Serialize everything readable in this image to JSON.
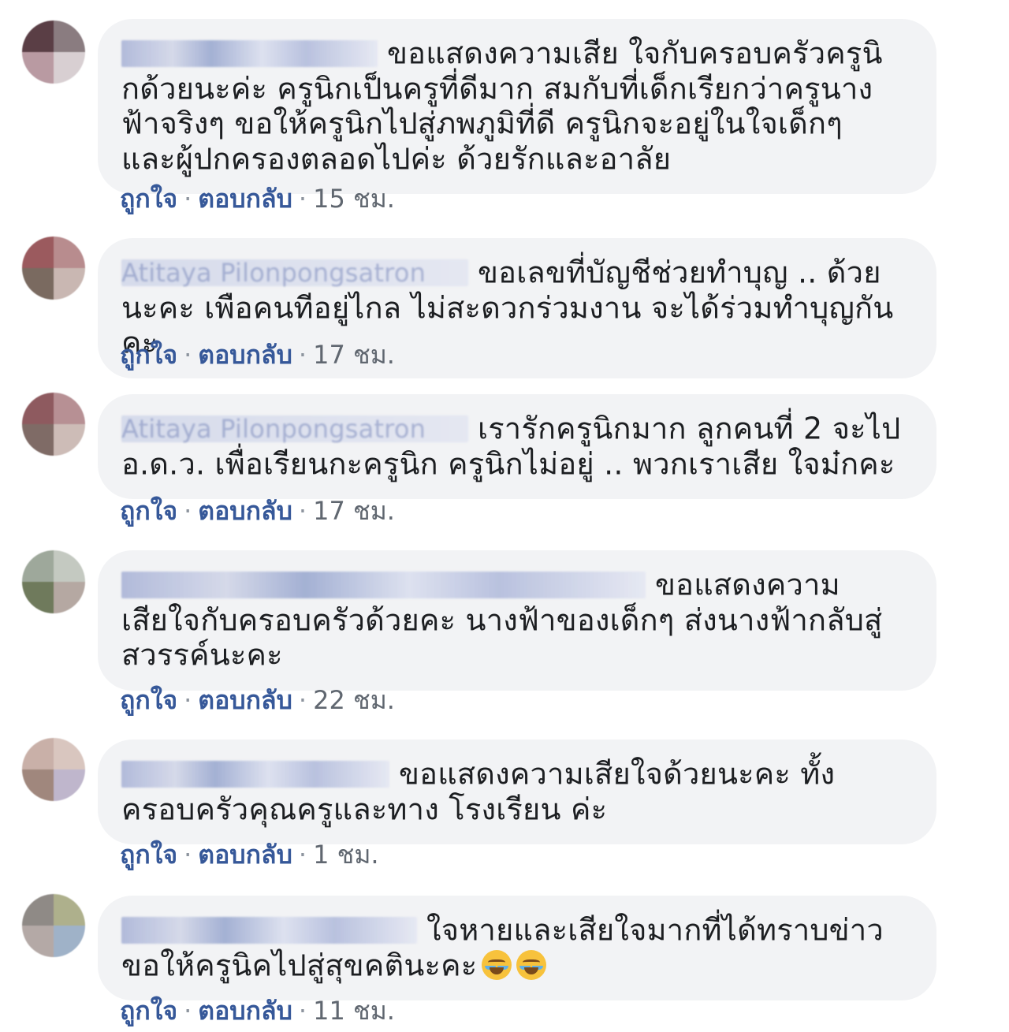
{
  "comments": [
    {
      "author": "",
      "text": "ขอแสดงความเสีย ใจกับครอบครัวครูนิกด้วยนะค่ะ ครูนิกเป็นครูที่ดีมาก สมกับที่เด็กเรียกว่าครูนางฟ้าจริงๆ ขอให้ครูนิกไปสู่ภพภูมิที่ดี ครูนิกจะอยู่ในใจเด็กๆ และผู้ปกครองตลอดไปค่ะ ด้วยรักและอาลัย",
      "emoji": [],
      "like": "ถูกใจ",
      "reply": "ตอบกลับ",
      "time": "15 ชม."
    },
    {
      "author": "Atitaya Pilonpongsatron",
      "text": "ขอเลขที่บัญชีช่วยทำบุญ .. ด้วยนะคะ เพือคนทีอยู่ไกล ไม่สะดวกร่วมงาน จะได้ร่วมทำบุญกันคะ",
      "emoji": [],
      "like": "ถูกใจ",
      "reply": "ตอบกลับ",
      "time": "17 ชม."
    },
    {
      "author": "Atitaya Pilonpongsatron",
      "text": "เรารักครูนิกมาก ลูกคนที่ 2 จะไป อ.ด.ว. เพื่อเรียนกะครูนิก ครูนิกไม่อยู่ .. พวกเราเสีย ใจม๋กคะ",
      "emoji": [],
      "like": "ถูกใจ",
      "reply": "ตอบกลับ",
      "time": "17 ชม."
    },
    {
      "author": "",
      "text": "ขอแสดงความเสียใจกับครอบครัวด้วยคะ นางฟ้าของเด็กๆ ส่งนางฟ้ากลับสู่สวรรค์นะคะ",
      "emoji": [],
      "like": "ถูกใจ",
      "reply": "ตอบกลับ",
      "time": "22 ชม."
    },
    {
      "author": "",
      "text": "ขอแสดงความเสียใจด้วยนะคะ ทั้งครอบครัวคุณครูและทาง โรงเรียน ค่ะ",
      "emoji": [],
      "like": "ถูกใจ",
      "reply": "ตอบกลับ",
      "time": "1 ชม."
    },
    {
      "author": "",
      "text": "ใจหายและเสียใจมากที่ได้ทราบข่าว ขอให้ครูนิคไปสู่สุขคตินะคะ",
      "emoji": [
        "crying-face",
        "crying-face"
      ],
      "like": "ถูกใจ",
      "reply": "ตอบกลับ",
      "time": "11 ชม."
    }
  ],
  "separator": "·",
  "colors": {
    "bubble": "#f2f3f5",
    "text": "#1c1e21",
    "link": "#365899",
    "time": "#606770"
  }
}
